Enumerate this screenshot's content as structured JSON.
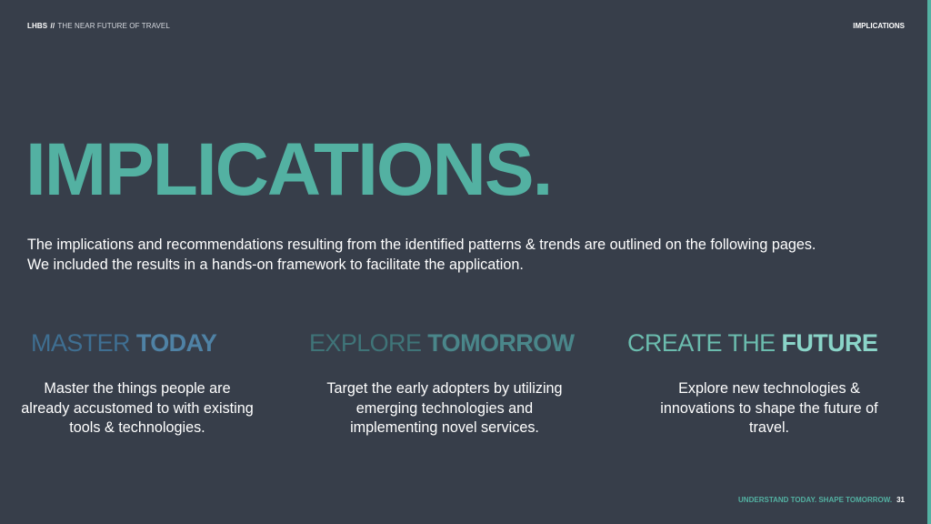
{
  "header": {
    "brand": "LHBS",
    "separator": "//",
    "subtitle": "THE NEAR FUTURE OF TRAVEL",
    "section": "IMPLICATIONS"
  },
  "headline": "IMPLICATIONS.",
  "intro": "The implications and recommendations resulting from the identified patterns & trends are outlined on the following pages.  We included the results in a hands-on framework to facilitate the application.",
  "columns": [
    {
      "light": "MASTER ",
      "bold": "TODAY",
      "text": "Master the things people are already accustomed to with existing tools & technologies."
    },
    {
      "light": "EXPLORE ",
      "bold": "TOMORROW",
      "text": "Target the early adopters by utilizing emerging technologies and implementing novel services."
    },
    {
      "light": "CREATE THE ",
      "bold": "FUTURE",
      "text": "Explore new technologies & innovations to shape the future of travel."
    }
  ],
  "footer": {
    "tagline": "UNDERSTAND TODAY. SHAPE TOMORROW.",
    "page_number": "31"
  },
  "colors": {
    "background": "#373e4a",
    "accent": "#53b1a2"
  }
}
